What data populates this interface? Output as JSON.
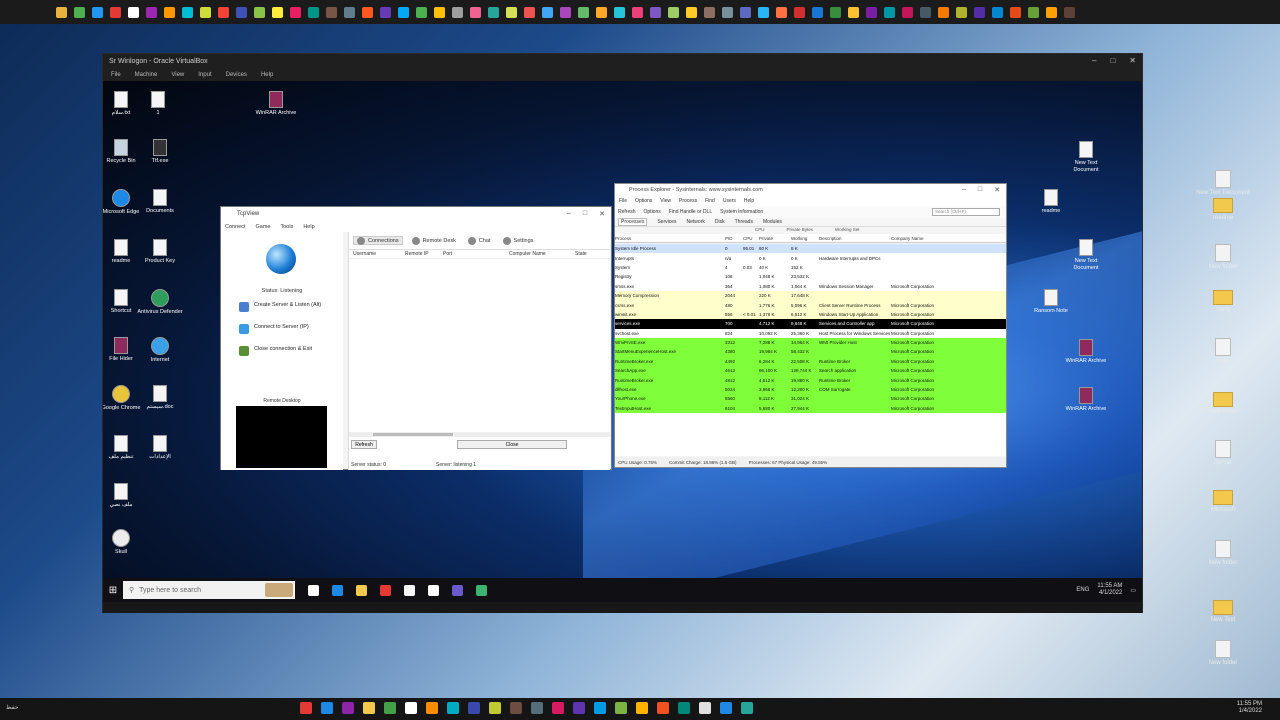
{
  "host_top_icons": [
    "#e8b23c",
    "#4caf50",
    "#2196f3",
    "#e53935",
    "#ffffff",
    "#9c27b0",
    "#ff9800",
    "#00bcd4",
    "#cddc39",
    "#f44336",
    "#3f51b5",
    "#8bc34a",
    "#ffeb3b",
    "#e91e63",
    "#009688",
    "#795548",
    "#607d8b",
    "#ff5722",
    "#673ab7",
    "#03a9f4",
    "#4caf50",
    "#ffc107",
    "#9e9e9e",
    "#f06292",
    "#26a69a",
    "#d4e157",
    "#ef5350",
    "#42a5f5",
    "#ab47bc",
    "#66bb6a",
    "#ffa726",
    "#26c6da",
    "#ec407a",
    "#7e57c2",
    "#9ccc65",
    "#ffca28",
    "#8d6e63",
    "#78909c",
    "#5c6bc0",
    "#29b6f6",
    "#ff7043",
    "#d32f2f",
    "#1976d2",
    "#388e3c",
    "#fbc02d",
    "#7b1fa2",
    "#0097a7",
    "#c2185b",
    "#455a64",
    "#f57c00",
    "#afb42b",
    "#512da8",
    "#0288d1",
    "#e64a19",
    "#689f38",
    "#ffa000",
    "#5d4037"
  ],
  "vm": {
    "title": "Sr Winlogon - Oracle VirtualBox",
    "controls": [
      "–",
      "□",
      "✕"
    ],
    "menu": [
      "File",
      "Machine",
      "View",
      "Input",
      "Devices",
      "Help"
    ],
    "desktop_icons": [
      {
        "label": "سلام.txt",
        "kind": "doc"
      },
      {
        "label": "1",
        "kind": "doc"
      },
      {
        "label": "WinRAR Archive",
        "kind": "rar"
      },
      {
        "label": "Recycle Bin",
        "kind": "bin"
      },
      {
        "label": "Ttf.exe",
        "kind": "app"
      },
      {
        "label": "Microsoft Edge",
        "kind": "edge"
      },
      {
        "label": "Documents",
        "kind": "doc"
      },
      {
        "label": "readme",
        "kind": "doc"
      },
      {
        "label": "Product Key",
        "kind": "doc"
      },
      {
        "label": "Shortcut",
        "kind": "doc"
      },
      {
        "label": "Antivirus Defender",
        "kind": "shield"
      },
      {
        "label": "File Hider",
        "kind": "rar"
      },
      {
        "label": "Internet",
        "kind": "globe"
      },
      {
        "label": "Google Chrome",
        "kind": "chrome"
      },
      {
        "label": "سيستم.doc",
        "kind": "doc"
      },
      {
        "label": "تنظيم ملف",
        "kind": "doc"
      },
      {
        "label": "الإعدادات",
        "kind": "doc"
      },
      {
        "label": "ملف نصي",
        "kind": "doc"
      },
      {
        "label": "Skull",
        "kind": "skull"
      }
    ],
    "taskbar": {
      "search_placeholder": "Type here to search",
      "apps": [
        "#ffffff",
        "#1e88e5",
        "#f2c94c",
        "#e53935",
        "#f5f5f5",
        "#ffffff",
        "#6a5acd",
        "#3cb371"
      ],
      "tray_text": "ENG",
      "time": "11:55 AM",
      "date": "4/1/2022"
    },
    "right_icons": [
      "New Text Document",
      "readme",
      "New Text Document",
      "Ransom Note",
      "WinRAR Archive",
      "WinRAR Archive"
    ]
  },
  "tcpview": {
    "title": "TcpView",
    "menu": [
      "Connect",
      "Game",
      "Tools",
      "Help"
    ],
    "status": "Status: Listening",
    "options": [
      {
        "label": "Create Server & Listen (Alt)",
        "color": "#4a7fd0"
      },
      {
        "label": "Connect to Server (IP)",
        "color": "#3a9be0"
      },
      {
        "label": "Close connection & Exit",
        "color": "#5a8f3a"
      }
    ],
    "preview_label": "Remote Desktop",
    "tabs": [
      "Connections",
      "Remote Desk",
      "Chat",
      "Settings"
    ],
    "columns": [
      "Username",
      "Remote IP",
      "Port",
      "Computer Name",
      "State"
    ],
    "buttons": [
      "Refresh",
      "Close"
    ],
    "status_left": "Server status: 0",
    "status_right": "Server: listening 1"
  },
  "procexp": {
    "title": "Process Explorer - Sysinternals: www.sysinternals.com",
    "menu": [
      "File",
      "Options",
      "View",
      "Process",
      "Find",
      "Users",
      "Help"
    ],
    "toolbar": [
      "Refresh",
      "Options",
      "Find Handle or DLL",
      "System Information"
    ],
    "search_placeholder": "Search (Ctrl+F)",
    "subtabs": [
      "Processes",
      "Services",
      "Network",
      "Disk",
      "Threads",
      "Modules"
    ],
    "subheader": [
      "CPU",
      "Private Bytes",
      "Working Set"
    ],
    "columns": [
      "Process",
      "PID",
      "CPU",
      "Private",
      "Working",
      "Description",
      "Company Name"
    ],
    "rows": [
      {
        "name": "System Idle Process",
        "pid": "0",
        "cpu": "95.01",
        "priv": "60 K",
        "ws": "8 K",
        "desc": "",
        "company": "",
        "bg": "#cfe3ff"
      },
      {
        "name": "Interrupts",
        "pid": "n/a",
        "cpu": "",
        "priv": "0 K",
        "ws": "0 K",
        "desc": "Hardware Interrupts and DPCs",
        "company": "",
        "bg": "#ffffff"
      },
      {
        "name": "System",
        "pid": "4",
        "cpu": "0.03",
        "priv": "40 K",
        "ws": "152 K",
        "desc": "",
        "company": "",
        "bg": "#ffffff"
      },
      {
        "name": "Registry",
        "pid": "108",
        "cpu": "",
        "priv": "1,048 K",
        "ws": "23,532 K",
        "desc": "",
        "company": "",
        "bg": "#ffffff"
      },
      {
        "name": "smss.exe",
        "pid": "364",
        "cpu": "",
        "priv": "1,080 K",
        "ws": "1,064 K",
        "desc": "Windows Session Manager",
        "company": "Microsoft Corporation",
        "bg": "#ffffff"
      },
      {
        "name": "Memory Compression",
        "pid": "2044",
        "cpu": "",
        "priv": "220 K",
        "ws": "17,648 K",
        "desc": "",
        "company": "",
        "bg": "#ffffcc"
      },
      {
        "name": "csrss.exe",
        "pid": "480",
        "cpu": "",
        "priv": "1,776 K",
        "ws": "5,096 K",
        "desc": "Client Server Runtime Process",
        "company": "Microsoft Corporation",
        "bg": "#ffffcc"
      },
      {
        "name": "wininit.exe",
        "pid": "556",
        "cpu": "< 0.01",
        "priv": "1,376 K",
        "ws": "6,512 K",
        "desc": "Windows Start-Up Application",
        "company": "Microsoft Corporation",
        "bg": "#ffffcc"
      },
      {
        "name": "services.exe",
        "pid": "700",
        "cpu": "",
        "priv": "4,712 K",
        "ws": "9,848 K",
        "desc": "Services and Controller app",
        "company": "Microsoft Corporation",
        "bg": "#000000",
        "fg": "#ffffff"
      },
      {
        "name": "svchost.exe",
        "pid": "824",
        "cpu": "",
        "priv": "10,092 K",
        "ws": "25,360 K",
        "desc": "Host Process for Windows Services",
        "company": "Microsoft Corporation",
        "bg": "#ffffff"
      },
      {
        "name": "WmiPrvSE.exe",
        "pid": "3312",
        "cpu": "",
        "priv": "7,288 K",
        "ws": "14,964 K",
        "desc": "WMI Provider Host",
        "company": "Microsoft Corporation",
        "bg": "#7fff3a"
      },
      {
        "name": "StartMenuExperienceHost.exe",
        "pid": "4380",
        "cpu": "",
        "priv": "19,964 K",
        "ws": "58,432 K",
        "desc": "",
        "company": "Microsoft Corporation",
        "bg": "#7fff3a"
      },
      {
        "name": "RuntimeBroker.exe",
        "pid": "4492",
        "cpu": "",
        "priv": "6,284 K",
        "ws": "22,508 K",
        "desc": "Runtime Broker",
        "company": "Microsoft Corporation",
        "bg": "#7fff3a"
      },
      {
        "name": "SearchApp.exe",
        "pid": "4612",
        "cpu": "",
        "priv": "86,100 K",
        "ws": "128,744 K",
        "desc": "Search application",
        "company": "Microsoft Corporation",
        "bg": "#7fff3a"
      },
      {
        "name": "RuntimeBroker.exe",
        "pid": "4812",
        "cpu": "",
        "priv": "4,512 K",
        "ws": "19,880 K",
        "desc": "Runtime Broker",
        "company": "Microsoft Corporation",
        "bg": "#7fff3a"
      },
      {
        "name": "dllhost.exe",
        "pid": "5024",
        "cpu": "",
        "priv": "3,968 K",
        "ws": "12,200 K",
        "desc": "COM Surrogate",
        "company": "Microsoft Corporation",
        "bg": "#7fff3a"
      },
      {
        "name": "YourPhone.exe",
        "pid": "5560",
        "cpu": "",
        "priv": "8,112 K",
        "ws": "31,024 K",
        "desc": "",
        "company": "Microsoft Corporation",
        "bg": "#7fff3a"
      },
      {
        "name": "TextInputHost.exe",
        "pid": "6104",
        "cpu": "",
        "priv": "5,680 K",
        "ws": "27,944 K",
        "desc": "",
        "company": "Microsoft Corporation",
        "bg": "#7fff3a"
      }
    ],
    "status": [
      "CPU Usage: 0.75%",
      "Commit Charge: 18.86% (1.5 GB)",
      "Processes: 67  Physical Usage: 49.55%"
    ]
  },
  "host_bottom": {
    "left_text": "حفظ",
    "apps": [
      "#e53935",
      "#1e88e5",
      "#8e24aa",
      "#f2c94c",
      "#43a047",
      "#ffffff",
      "#fb8c00",
      "#00acc1",
      "#3949ab",
      "#c0ca33",
      "#6d4c41",
      "#546e7a",
      "#d81b60",
      "#5e35b1",
      "#039be5",
      "#7cb342",
      "#ffb300",
      "#f4511e",
      "#00897b",
      "#e0e0e0",
      "#1e88e5",
      "#26a69a"
    ],
    "time": "11:55 PM",
    "date": "1/4/2022"
  },
  "host_right_icons": [
    "New Text Document",
    "readme",
    "New folder",
    "Sorry",
    "Task",
    "New folder",
    "Server",
    "Microsoft",
    "New folder",
    "New Text",
    "New folder"
  ]
}
